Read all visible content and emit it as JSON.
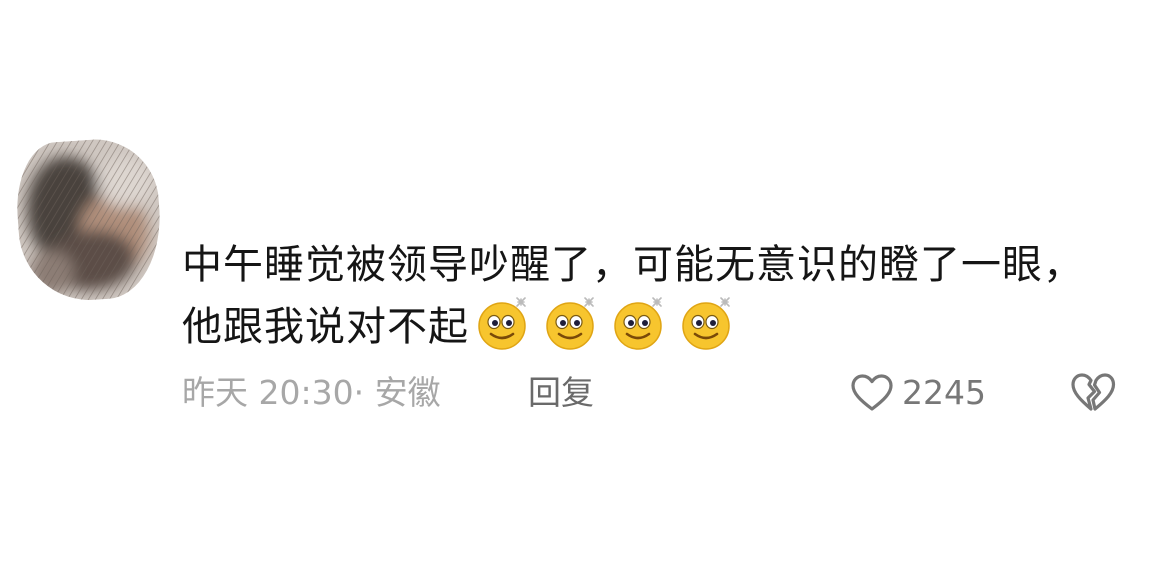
{
  "comment": {
    "text": "中午睡觉被领导吵醒了，可能无意识的瞪了一眼，他跟我说对不起",
    "emojis": [
      "dazed-face-emoji",
      "dazed-face-emoji",
      "dazed-face-emoji",
      "dazed-face-emoji"
    ],
    "timestamp": "昨天 20:30",
    "separator": "·",
    "location": "安徽",
    "reply_label": "回复",
    "like_count": "2245"
  },
  "icons": {
    "like": "heart-outline-icon",
    "dislike": "broken-heart-icon"
  },
  "colors": {
    "text": "#151515",
    "meta": "#a7a7a7",
    "reply": "#6a6a6a",
    "icon": "#777777",
    "background": "#ffffff"
  }
}
